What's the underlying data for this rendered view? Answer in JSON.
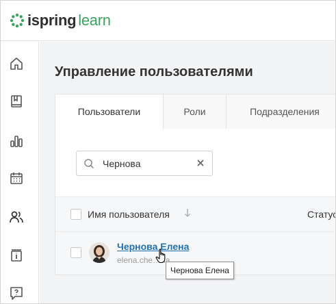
{
  "app": {
    "logo_ispring": "ispring",
    "logo_learn": "learn",
    "brand_color": "#3aa35d"
  },
  "sidebar": {
    "items": [
      {
        "icon": "home-icon"
      },
      {
        "icon": "book-icon"
      },
      {
        "icon": "bar-chart-icon"
      },
      {
        "icon": "calendar-icon"
      },
      {
        "icon": "users-icon"
      },
      {
        "icon": "info-icon"
      },
      {
        "icon": "help-icon"
      }
    ]
  },
  "page": {
    "title": "Управление пользователями"
  },
  "tabs": [
    {
      "label": "Пользователи",
      "active": true
    },
    {
      "label": "Роли",
      "active": false
    },
    {
      "label": "Подразделения",
      "active": false
    }
  ],
  "search": {
    "value": "Чернова"
  },
  "table": {
    "columns": {
      "name": "Имя пользователя",
      "status": "Статус"
    },
    "rows": [
      {
        "name": "Чернова Елена",
        "email": "elena.che…na"
      }
    ]
  },
  "tooltip": {
    "text": "Чернова Елена"
  },
  "colors": {
    "link": "#1f6fb2",
    "background": "#f3f4f6"
  }
}
